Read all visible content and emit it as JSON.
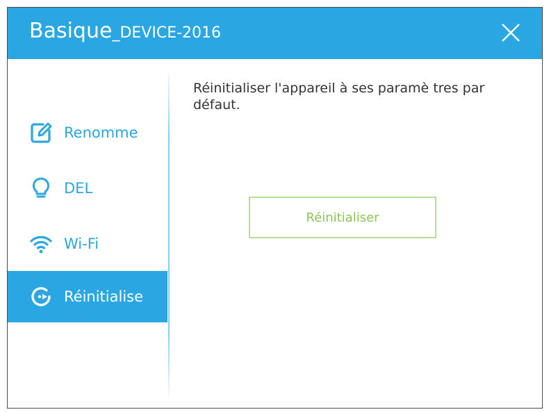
{
  "window": {
    "title_main": "Basique",
    "title_sub": "_DEVICE-2016",
    "close_icon": "close-icon"
  },
  "sidebar": {
    "items": [
      {
        "label": "Renomme",
        "icon": "edit-icon",
        "active": false
      },
      {
        "label": "DEL",
        "icon": "bulb-icon",
        "active": false
      },
      {
        "label": "Wi-Fi",
        "icon": "wifi-icon",
        "active": false
      },
      {
        "label": "Réinitialise",
        "icon": "reset-icon",
        "active": true
      }
    ]
  },
  "main": {
    "description": "Réinitialiser l'appareil à ses paramè tres par défaut.",
    "reset_button_label": "Réinitialiser"
  },
  "colors": {
    "accent": "#2aa6e2",
    "button_border": "#b5de8e",
    "button_text": "#8dc555"
  }
}
